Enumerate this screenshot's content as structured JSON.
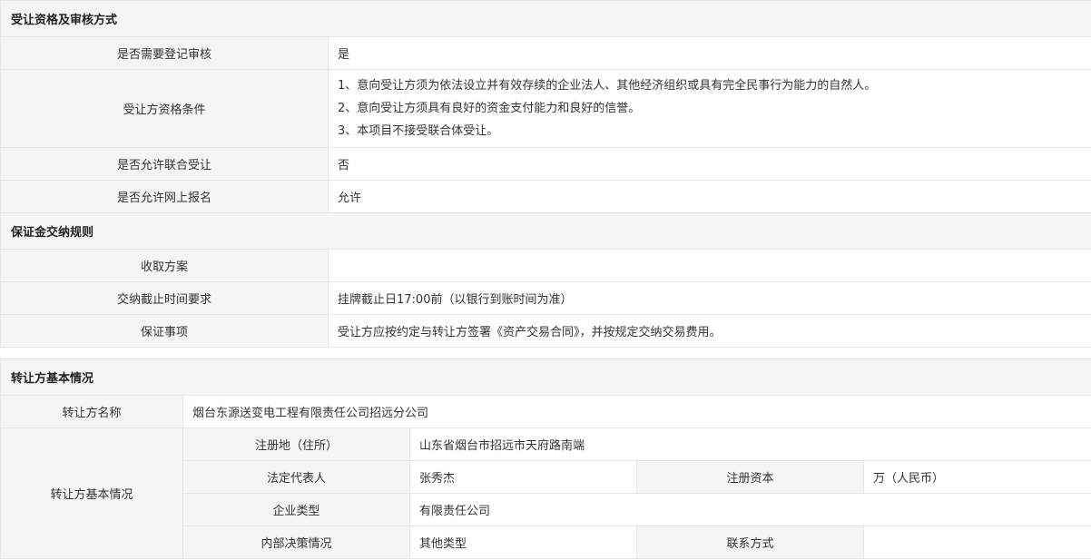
{
  "section1": {
    "title": "受让资格及审核方式",
    "rows": [
      {
        "label": "是否需要登记审核",
        "value": "是"
      },
      {
        "label": "受让方资格条件",
        "lines": [
          "1、意向受让方须为依法设立并有效存续的企业法人、其他经济组织或具有完全民事行为能力的自然人。",
          "2、意向受让方须具有良好的资金支付能力和良好的信誉。",
          "3、本项目不接受联合体受让。"
        ]
      },
      {
        "label": "是否允许联合受让",
        "value": "否"
      },
      {
        "label": "是否允许网上报名",
        "value": "允许"
      }
    ]
  },
  "section2": {
    "title": "保证金交纳规则",
    "rows": [
      {
        "label": "收取方案",
        "value": ""
      },
      {
        "label": "交纳截止时间要求",
        "value": "挂牌截止日17:00前（以银行到账时间为准）"
      },
      {
        "label": "保证事项",
        "value": "受让方应按约定与转让方签署《资产交易合同》，并按规定交纳交易费用。"
      }
    ]
  },
  "section3": {
    "title": "转让方基本情况",
    "name_label": "转让方名称",
    "name_value": "烟台东源送变电工程有限责任公司招远分公司",
    "basic_label": "转让方基本情况",
    "reg_label": "注册地（住所）",
    "reg_value": "山东省烟台市招远市天府路南端",
    "rep_label": "法定代表人",
    "rep_value": "张秀杰",
    "capital_label": "注册资本",
    "capital_value": "万（人民币）",
    "type_label": "企业类型",
    "type_value": "有限责任公司",
    "decision_label": "内部决策情况",
    "decision_value": "其他类型",
    "contact_label": "联系方式",
    "contact_value": ""
  }
}
